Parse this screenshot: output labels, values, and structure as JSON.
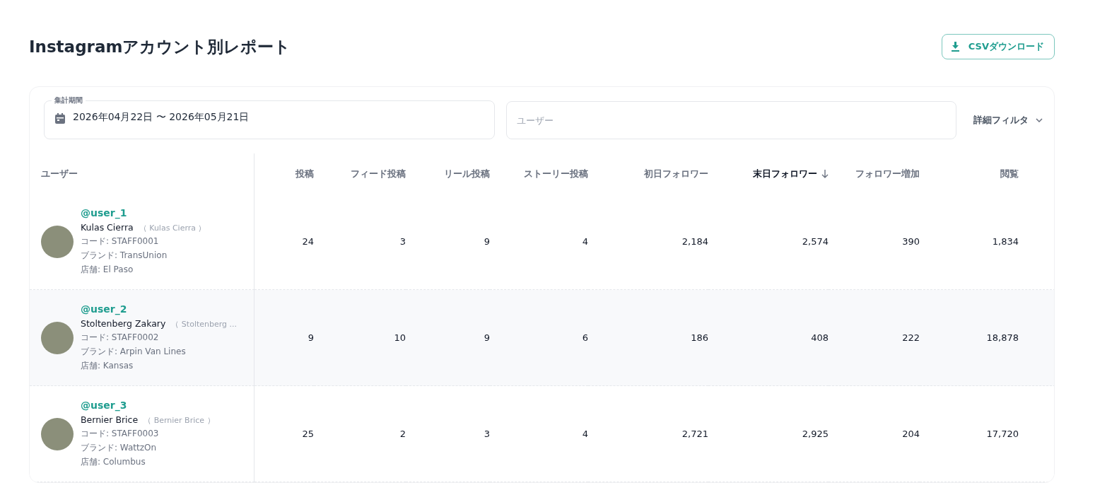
{
  "title": "Instagramアカウント別レポート",
  "download_button": {
    "label": "CSVダウンロード"
  },
  "filters": {
    "period": {
      "label": "集計期間",
      "value": "2026年04月22日 〜 2026年05月21日"
    },
    "user": {
      "placeholder": "ユーザー"
    },
    "advanced": {
      "label": "詳細フィルタ",
      "expanded": false
    }
  },
  "table": {
    "columns": [
      {
        "label": "ユーザー",
        "sorted": false
      },
      {
        "label": "投稿",
        "sorted": false
      },
      {
        "label": "フィード投稿",
        "sorted": false
      },
      {
        "label": "リール投稿",
        "sorted": false
      },
      {
        "label": "ストーリー投稿",
        "sorted": false
      },
      {
        "label": "初日フォロワー",
        "sorted": false
      },
      {
        "label": "末日フォロワー",
        "sorted": true
      },
      {
        "label": "フォロワー増加",
        "sorted": false
      },
      {
        "label": "閲覧",
        "sorted": false
      }
    ],
    "rows": [
      {
        "handle": "@user_1",
        "name": "Kulas Cierra",
        "alias": "（ Kulas Cierra ）",
        "code": "コード: STAFF0001",
        "brand": "ブランド: TransUnion",
        "store": "店舗: El Paso",
        "values": [
          "24",
          "3",
          "9",
          "4",
          "2,184",
          "2,574",
          "390",
          "1,834"
        ]
      },
      {
        "handle": "@user_2",
        "name": "Stoltenberg Zakary",
        "alias": "（ Stoltenberg ...",
        "code": "コード: STAFF0002",
        "brand": "ブランド: Arpin Van Lines",
        "store": "店舗: Kansas",
        "values": [
          "9",
          "10",
          "9",
          "6",
          "186",
          "408",
          "222",
          "18,878"
        ]
      },
      {
        "handle": "@user_3",
        "name": "Bernier Brice",
        "alias": "（ Bernier Brice ）",
        "code": "コード: STAFF0003",
        "brand": "ブランド: WattzOn",
        "store": "店舗: Columbus",
        "values": [
          "25",
          "2",
          "3",
          "4",
          "2,721",
          "2,925",
          "204",
          "17,720"
        ]
      }
    ]
  }
}
